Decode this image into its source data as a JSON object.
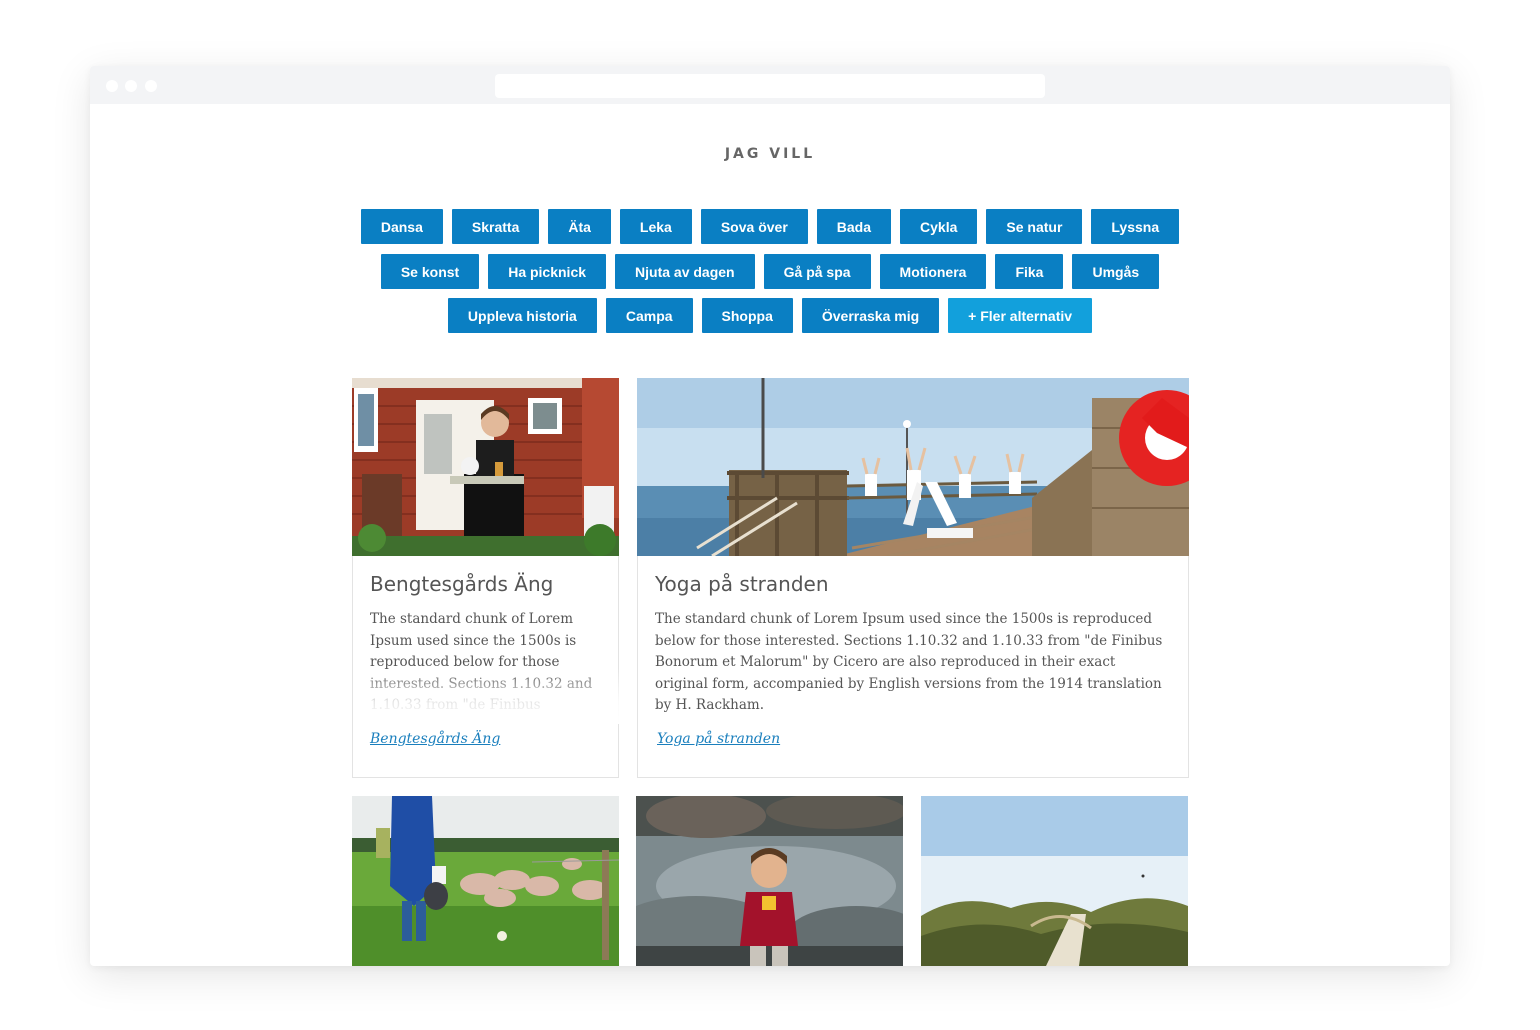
{
  "section": {
    "heading": "JAG VILL"
  },
  "filters": {
    "row1": [
      "Dansa",
      "Skratta",
      "Äta",
      "Leka",
      "Sova över",
      "Bada",
      "Cykla",
      "Se natur",
      "Lyssna"
    ],
    "row2": [
      "Se konst",
      "Ha picknick",
      "Njuta av dagen",
      "Gå på spa",
      "Motionera",
      "Fika",
      "Umgås"
    ],
    "row3": [
      "Uppleva historia",
      "Campa",
      "Shoppa",
      "Överraska mig"
    ],
    "more_label": "+ Fler alternativ"
  },
  "cards": [
    {
      "title": "Bengtesgårds Äng",
      "description": "The standard chunk of Lorem Ipsum used since the 1500s is reproduced below for those interested. Sections 1.10.32 and 1.10.33 from \"de Finibus Bonorum et Malorum\" by Cicero are also reproduced.",
      "link": "Bengtesgårds Äng"
    },
    {
      "title": "Yoga på stranden",
      "description": "The standard chunk of Lorem Ipsum used since the 1500s is reproduced below for those interested. Sections 1.10.32 and 1.10.33 from \"de Finibus Bonorum et Malorum\" by Cicero are also reproduced in their exact original form, accompanied by English versions from the 1914 translation by H. Rackham.",
      "link": "Yoga på stranden"
    }
  ],
  "colors": {
    "button": "#0a7fc3",
    "button_more": "#12a0dc",
    "link": "#1a7fbd"
  }
}
